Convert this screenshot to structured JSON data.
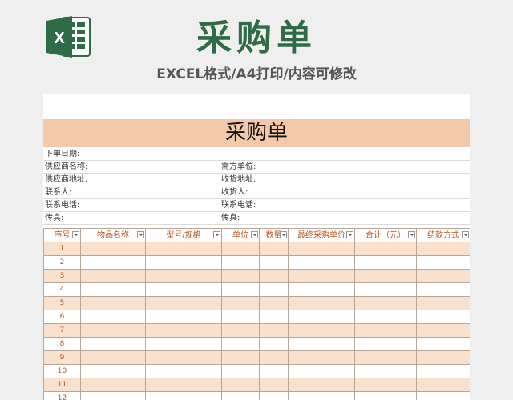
{
  "header": {
    "title": "采购单",
    "subtitle": "EXCEL格式/A4打印/内容可修改",
    "logo_icon": "excel-logo-icon"
  },
  "sheet": {
    "title": "采购单",
    "info_rows": [
      {
        "left": "下单日期:",
        "right": ""
      },
      {
        "left": "供应商名称:",
        "right": "需方单位:"
      },
      {
        "left": "供应商地址:",
        "right": "收货地址:"
      },
      {
        "left": "联系人:",
        "right": "收货人:"
      },
      {
        "left": "联系电话:",
        "right": "联系电话:"
      },
      {
        "left": "传真:",
        "right": "传真:"
      }
    ],
    "columns": [
      "序号",
      "物品名称",
      "型号/规格",
      "单位",
      "数量",
      "最终采购单价",
      "合计（元）",
      "结款方式"
    ],
    "row_numbers": [
      "1",
      "2",
      "3",
      "4",
      "5",
      "6",
      "7",
      "8",
      "9",
      "10",
      "11",
      "12"
    ],
    "colors": {
      "title_band": "#f3c9a9",
      "row_stripe": "#f9e1ce",
      "header_text": "#b5551d",
      "brand_green": "#2e6b46"
    }
  }
}
